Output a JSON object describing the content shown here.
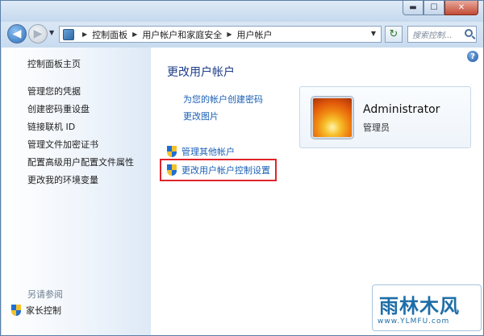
{
  "window": {
    "buttons": {
      "minimize": "▬",
      "maximize": "☐",
      "close": "✕"
    }
  },
  "nav": {
    "back_glyph": "◀",
    "forward_glyph": "▶",
    "breadcrumb": [
      "控制面板",
      "用户帐户和家庭安全",
      "用户帐户"
    ],
    "search_placeholder": "搜索控制...",
    "refresh_glyph": "↻"
  },
  "sidebar": {
    "home": "控制面板主页",
    "items": [
      "管理您的凭据",
      "创建密码重设盘",
      "链接联机 ID",
      "管理文件加密证书",
      "配置高级用户配置文件属性",
      "更改我的环境变量"
    ],
    "see_also_heading": "另请参阅",
    "see_also_items": [
      "家长控制"
    ]
  },
  "main": {
    "title": "更改用户帐户",
    "links": [
      "为您的帐户创建密码",
      "更改图片"
    ],
    "shield_links": [
      "管理其他帐户",
      "更改用户帐户控制设置"
    ],
    "help_glyph": "?"
  },
  "user": {
    "name": "Administrator",
    "role": "管理员"
  },
  "watermark": {
    "big": "雨林木风",
    "small": "www.YLMFU.com"
  },
  "colors": {
    "link": "#1a5fb4",
    "title": "#1e3d8a",
    "highlight_border": "#e0242b"
  }
}
